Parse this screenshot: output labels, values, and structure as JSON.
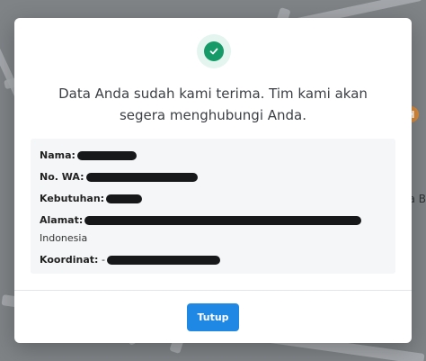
{
  "background": {
    "map_labels": [
      "H",
      "a B"
    ]
  },
  "modal": {
    "icon": "check-circle-icon",
    "message": "Data Anda sudah kami terima. Tim kami akan segera menghubungi Anda.",
    "details": {
      "nama_label": "Nama:",
      "wa_label": "No. WA:",
      "kebutuhan_label": "Kebutuhan:",
      "alamat_label": "Alamat:",
      "alamat_country": "Indonesia",
      "koordinat_label": "Koordinat:",
      "koordinat_prefix": "-"
    },
    "close_button": "Tutup"
  },
  "colors": {
    "success": "#159a68",
    "primary_button": "#1f88e5"
  }
}
